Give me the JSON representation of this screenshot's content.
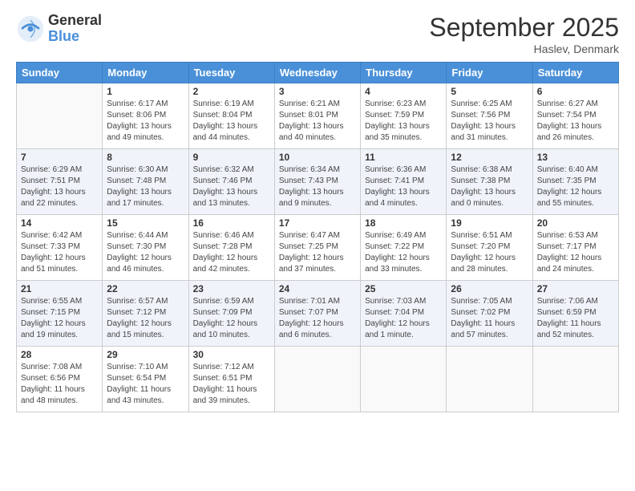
{
  "header": {
    "logo_general": "General",
    "logo_blue": "Blue",
    "month_title": "September 2025",
    "location": "Haslev, Denmark"
  },
  "days_of_week": [
    "Sunday",
    "Monday",
    "Tuesday",
    "Wednesday",
    "Thursday",
    "Friday",
    "Saturday"
  ],
  "weeks": [
    [
      {
        "day": "",
        "info": ""
      },
      {
        "day": "1",
        "info": "Sunrise: 6:17 AM\nSunset: 8:06 PM\nDaylight: 13 hours\nand 49 minutes."
      },
      {
        "day": "2",
        "info": "Sunrise: 6:19 AM\nSunset: 8:04 PM\nDaylight: 13 hours\nand 44 minutes."
      },
      {
        "day": "3",
        "info": "Sunrise: 6:21 AM\nSunset: 8:01 PM\nDaylight: 13 hours\nand 40 minutes."
      },
      {
        "day": "4",
        "info": "Sunrise: 6:23 AM\nSunset: 7:59 PM\nDaylight: 13 hours\nand 35 minutes."
      },
      {
        "day": "5",
        "info": "Sunrise: 6:25 AM\nSunset: 7:56 PM\nDaylight: 13 hours\nand 31 minutes."
      },
      {
        "day": "6",
        "info": "Sunrise: 6:27 AM\nSunset: 7:54 PM\nDaylight: 13 hours\nand 26 minutes."
      }
    ],
    [
      {
        "day": "7",
        "info": "Sunrise: 6:29 AM\nSunset: 7:51 PM\nDaylight: 13 hours\nand 22 minutes."
      },
      {
        "day": "8",
        "info": "Sunrise: 6:30 AM\nSunset: 7:48 PM\nDaylight: 13 hours\nand 17 minutes."
      },
      {
        "day": "9",
        "info": "Sunrise: 6:32 AM\nSunset: 7:46 PM\nDaylight: 13 hours\nand 13 minutes."
      },
      {
        "day": "10",
        "info": "Sunrise: 6:34 AM\nSunset: 7:43 PM\nDaylight: 13 hours\nand 9 minutes."
      },
      {
        "day": "11",
        "info": "Sunrise: 6:36 AM\nSunset: 7:41 PM\nDaylight: 13 hours\nand 4 minutes."
      },
      {
        "day": "12",
        "info": "Sunrise: 6:38 AM\nSunset: 7:38 PM\nDaylight: 13 hours\nand 0 minutes."
      },
      {
        "day": "13",
        "info": "Sunrise: 6:40 AM\nSunset: 7:35 PM\nDaylight: 12 hours\nand 55 minutes."
      }
    ],
    [
      {
        "day": "14",
        "info": "Sunrise: 6:42 AM\nSunset: 7:33 PM\nDaylight: 12 hours\nand 51 minutes."
      },
      {
        "day": "15",
        "info": "Sunrise: 6:44 AM\nSunset: 7:30 PM\nDaylight: 12 hours\nand 46 minutes."
      },
      {
        "day": "16",
        "info": "Sunrise: 6:46 AM\nSunset: 7:28 PM\nDaylight: 12 hours\nand 42 minutes."
      },
      {
        "day": "17",
        "info": "Sunrise: 6:47 AM\nSunset: 7:25 PM\nDaylight: 12 hours\nand 37 minutes."
      },
      {
        "day": "18",
        "info": "Sunrise: 6:49 AM\nSunset: 7:22 PM\nDaylight: 12 hours\nand 33 minutes."
      },
      {
        "day": "19",
        "info": "Sunrise: 6:51 AM\nSunset: 7:20 PM\nDaylight: 12 hours\nand 28 minutes."
      },
      {
        "day": "20",
        "info": "Sunrise: 6:53 AM\nSunset: 7:17 PM\nDaylight: 12 hours\nand 24 minutes."
      }
    ],
    [
      {
        "day": "21",
        "info": "Sunrise: 6:55 AM\nSunset: 7:15 PM\nDaylight: 12 hours\nand 19 minutes."
      },
      {
        "day": "22",
        "info": "Sunrise: 6:57 AM\nSunset: 7:12 PM\nDaylight: 12 hours\nand 15 minutes."
      },
      {
        "day": "23",
        "info": "Sunrise: 6:59 AM\nSunset: 7:09 PM\nDaylight: 12 hours\nand 10 minutes."
      },
      {
        "day": "24",
        "info": "Sunrise: 7:01 AM\nSunset: 7:07 PM\nDaylight: 12 hours\nand 6 minutes."
      },
      {
        "day": "25",
        "info": "Sunrise: 7:03 AM\nSunset: 7:04 PM\nDaylight: 12 hours\nand 1 minute."
      },
      {
        "day": "26",
        "info": "Sunrise: 7:05 AM\nSunset: 7:02 PM\nDaylight: 11 hours\nand 57 minutes."
      },
      {
        "day": "27",
        "info": "Sunrise: 7:06 AM\nSunset: 6:59 PM\nDaylight: 11 hours\nand 52 minutes."
      }
    ],
    [
      {
        "day": "28",
        "info": "Sunrise: 7:08 AM\nSunset: 6:56 PM\nDaylight: 11 hours\nand 48 minutes."
      },
      {
        "day": "29",
        "info": "Sunrise: 7:10 AM\nSunset: 6:54 PM\nDaylight: 11 hours\nand 43 minutes."
      },
      {
        "day": "30",
        "info": "Sunrise: 7:12 AM\nSunset: 6:51 PM\nDaylight: 11 hours\nand 39 minutes."
      },
      {
        "day": "",
        "info": ""
      },
      {
        "day": "",
        "info": ""
      },
      {
        "day": "",
        "info": ""
      },
      {
        "day": "",
        "info": ""
      }
    ]
  ]
}
